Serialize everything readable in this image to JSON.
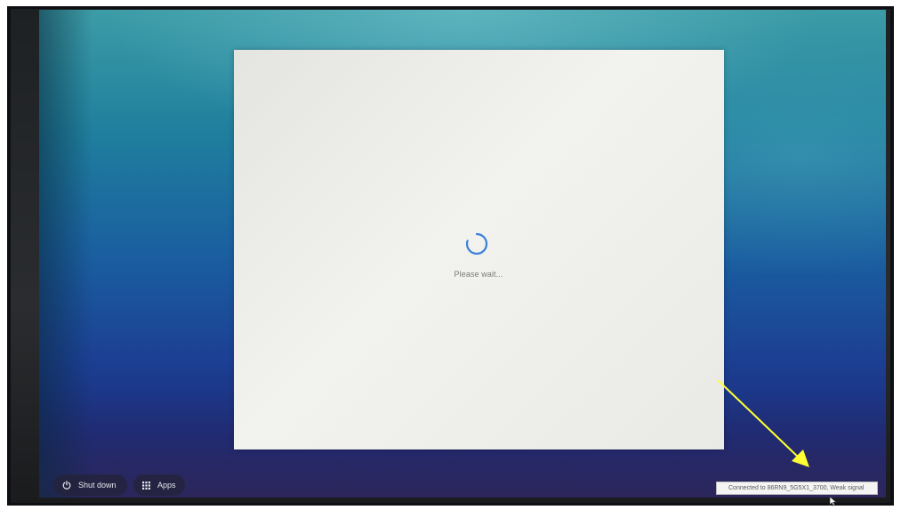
{
  "dialog": {
    "status_text": "Please wait..."
  },
  "shelf": {
    "shutdown_label": "Shut down",
    "shutdown_icon": "power-icon",
    "apps_label": "Apps",
    "apps_icon": "grid-icon"
  },
  "network_tooltip": {
    "text": "Connected to 86RN9_5G5X1_3700, Weak signal"
  },
  "colors": {
    "spinner": "#3b7fd9",
    "annotation_arrow": "#ffff33",
    "wallpaper_top": "#3c9ca6",
    "wallpaper_bottom": "#24245e"
  }
}
